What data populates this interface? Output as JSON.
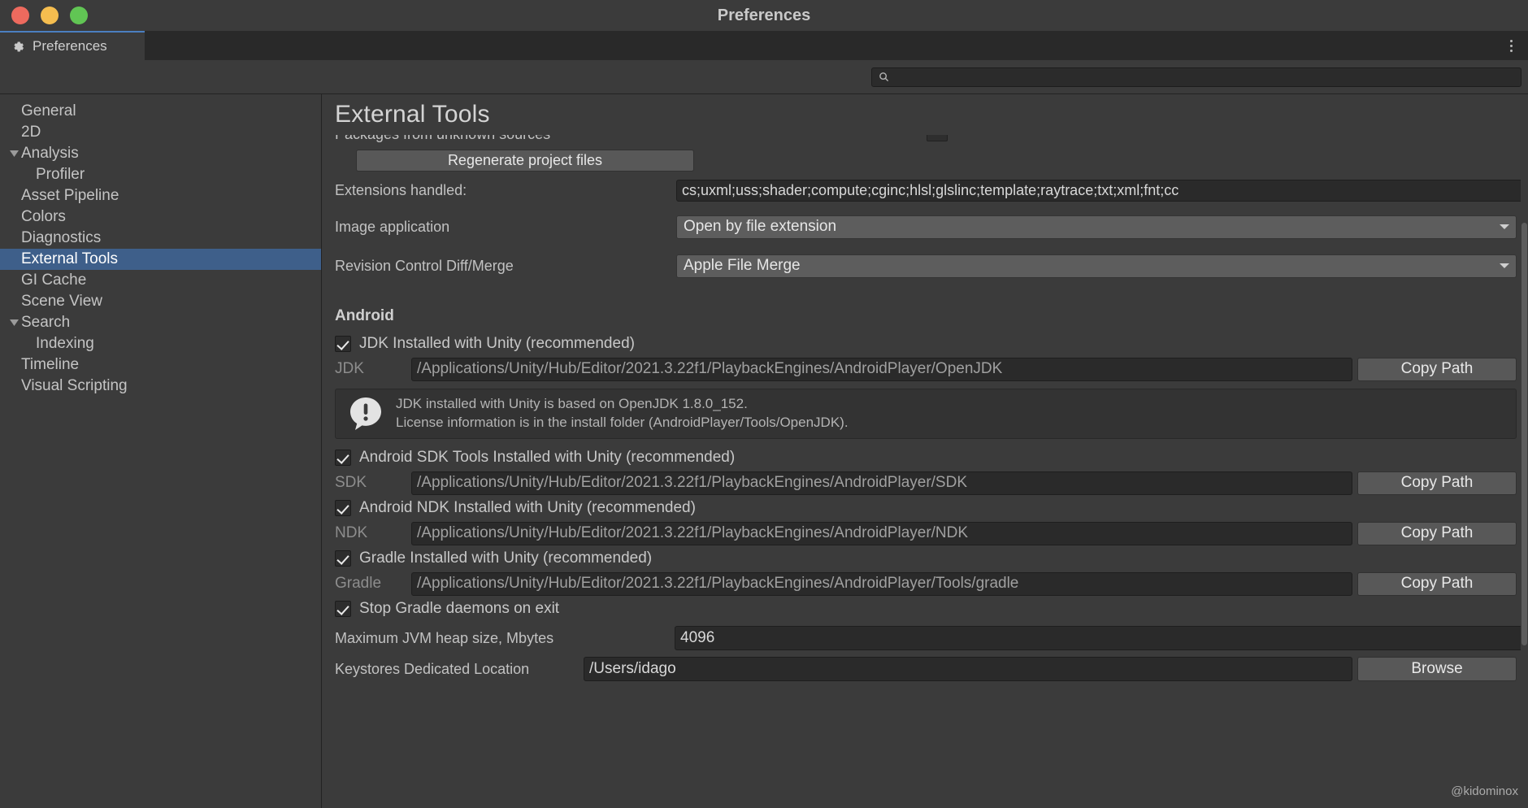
{
  "window": {
    "title": "Preferences",
    "traffic_lights": [
      "close-red",
      "minimize-yellow",
      "maximize-green"
    ]
  },
  "tab": {
    "label": "Preferences",
    "icon": "gear-icon",
    "overflow_icon": "kebab-menu-icon"
  },
  "search": {
    "value": "",
    "placeholder": "",
    "icon": "search-icon"
  },
  "sidebar": {
    "items": [
      {
        "label": "General",
        "indent": 0,
        "arrow": "none",
        "selected": false
      },
      {
        "label": "2D",
        "indent": 0,
        "arrow": "none",
        "selected": false
      },
      {
        "label": "Analysis",
        "indent": 0,
        "arrow": "expanded",
        "selected": false
      },
      {
        "label": "Profiler",
        "indent": 1,
        "arrow": "none",
        "selected": false
      },
      {
        "label": "Asset Pipeline",
        "indent": 0,
        "arrow": "none",
        "selected": false
      },
      {
        "label": "Colors",
        "indent": 0,
        "arrow": "none",
        "selected": false
      },
      {
        "label": "Diagnostics",
        "indent": 0,
        "arrow": "none",
        "selected": false
      },
      {
        "label": "External Tools",
        "indent": 0,
        "arrow": "none",
        "selected": true
      },
      {
        "label": "GI Cache",
        "indent": 0,
        "arrow": "none",
        "selected": false
      },
      {
        "label": "Scene View",
        "indent": 0,
        "arrow": "none",
        "selected": false
      },
      {
        "label": "Search",
        "indent": 0,
        "arrow": "expanded",
        "selected": false
      },
      {
        "label": "Indexing",
        "indent": 1,
        "arrow": "none",
        "selected": false
      },
      {
        "label": "Timeline",
        "indent": 0,
        "arrow": "none",
        "selected": false
      },
      {
        "label": "Visual Scripting",
        "indent": 0,
        "arrow": "none",
        "selected": false
      }
    ]
  },
  "main": {
    "title": "External Tools",
    "clipped_row_label": "Packages from unknown sources",
    "regenerate_button": "Regenerate project files",
    "extensions": {
      "label": "Extensions handled:",
      "value": "cs;uxml;uss;shader;compute;cginc;hlsl;glslinc;template;raytrace;txt;xml;fnt;cc"
    },
    "image_application": {
      "label": "Image application",
      "value": "Open by file extension"
    },
    "revision_control": {
      "label": "Revision Control Diff/Merge",
      "value": "Apple File Merge"
    },
    "android": {
      "heading": "Android",
      "jdk_checkbox": {
        "label": "JDK Installed with Unity (recommended)",
        "checked": true
      },
      "jdk_path": {
        "label": "JDK",
        "value": "/Applications/Unity/Hub/Editor/2021.3.22f1/PlaybackEngines/AndroidPlayer/OpenJDK",
        "button": "Copy Path"
      },
      "info": {
        "icon": "info-bubble-icon",
        "line1": "JDK installed with Unity is based on OpenJDK 1.8.0_152.",
        "line2": "License information is in the install folder (AndroidPlayer/Tools/OpenJDK)."
      },
      "sdk_checkbox": {
        "label": "Android SDK Tools Installed with Unity (recommended)",
        "checked": true
      },
      "sdk_path": {
        "label": "SDK",
        "value": "/Applications/Unity/Hub/Editor/2021.3.22f1/PlaybackEngines/AndroidPlayer/SDK",
        "button": "Copy Path"
      },
      "ndk_checkbox": {
        "label": "Android NDK Installed with Unity (recommended)",
        "checked": true
      },
      "ndk_path": {
        "label": "NDK",
        "value": "/Applications/Unity/Hub/Editor/2021.3.22f1/PlaybackEngines/AndroidPlayer/NDK",
        "button": "Copy Path"
      },
      "gradle_checkbox": {
        "label": "Gradle Installed with Unity (recommended)",
        "checked": true
      },
      "gradle_path": {
        "label": "Gradle",
        "value": "/Applications/Unity/Hub/Editor/2021.3.22f1/PlaybackEngines/AndroidPlayer/Tools/gradle",
        "button": "Copy Path"
      },
      "stop_gradle_checkbox": {
        "label": "Stop Gradle daemons on exit",
        "checked": true
      },
      "jvm_heap": {
        "label": "Maximum JVM heap size, Mbytes",
        "value": "4096"
      },
      "keystores": {
        "label": "Keystores Dedicated Location",
        "value": "/Users/idago",
        "button": "Browse"
      }
    }
  },
  "watermark": "@kidominox",
  "colors": {
    "window_bg": "#3b3b3b",
    "tabstrip_bg": "#292929",
    "selection": "#3e5f8a",
    "tab_accent": "#4b7fc0",
    "field_bg": "#2a2a2a",
    "button_bg": "#585858",
    "dropdown_bg": "#5d5d5d",
    "text": "#c4c4c4"
  }
}
